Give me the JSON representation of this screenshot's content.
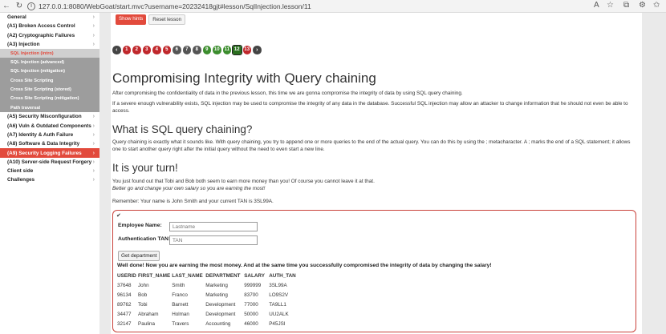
{
  "browser": {
    "url": "127.0.0.1:8080/WebGoat/start.mvc?username=20232418gjt#lesson/SqlInjection.lesson/11"
  },
  "toolbar": {
    "show_hints": "Show hints",
    "reset_lesson": "Reset lesson"
  },
  "sidebar": {
    "items_before": [
      {
        "label": "General"
      },
      {
        "label": "(A1) Broken Access Control"
      },
      {
        "label": "(A2) Cryptographic Failures"
      },
      {
        "label": "(A3) Injection"
      }
    ],
    "injection_subitems": [
      {
        "label": "SQL Injection (intro)"
      },
      {
        "label": "SQL Injection (advanced)"
      },
      {
        "label": "SQL Injection (mitigation)"
      },
      {
        "label": "Cross Site Scripting"
      },
      {
        "label": "Cross Site Scripting (stored)"
      },
      {
        "label": "Cross Site Scripting (mitigation)"
      },
      {
        "label": "Path traversal"
      }
    ],
    "items_after": [
      {
        "label": "(A5) Security Misconfiguration"
      },
      {
        "label": "(A6) Vuln & Outdated Components"
      },
      {
        "label": "(A7) Identity & Auth Failure"
      },
      {
        "label": "(A8) Software & Data Integrity"
      },
      {
        "label": "(A9) Security Logging Failures"
      },
      {
        "label": "(A10) Server-side Request Forgery"
      },
      {
        "label": "Client side"
      },
      {
        "label": "Challenges"
      }
    ]
  },
  "pager": {
    "pages": [
      "1",
      "2",
      "3",
      "4",
      "5",
      "6",
      "7",
      "8",
      "9",
      "10",
      "11",
      "12",
      "13"
    ],
    "current": "12"
  },
  "lesson": {
    "title": "Compromising Integrity with Query chaining",
    "intro": "After compromising the confidentiality of data in the previous lesson, this time we are gonna compromise the integrity of data by using SQL query chaining.",
    "para2": "If a severe enough vulnerability exists, SQL injection may be used to compromise the integrity of any data in the database. Successful SQL injection may allow an attacker to change information that he should not even be able to access.",
    "h2_chaining": "What is SQL query chaining?",
    "chaining_text": "Query chaining is exactly what it sounds like. With query chaining, you try to append one or more queries to the end of the actual query. You can do this by using the ; metacharacter. A ; marks the end of a SQL statement; it allows one to start another query right after the initial query without the need to even start a new line.",
    "h2_turn": "It is your turn!",
    "turn_line1": "You just found out that Tobi and Bob both seem to earn more money than you! Of course you cannot leave it at that.",
    "turn_line2": "Better go and change your own salary so you are earning the most!",
    "remember": "Remember: Your name is John Smith and your current TAN is 3SL99A."
  },
  "form": {
    "check_glyph": "✔",
    "employee_label": "Employee Name:",
    "employee_placeholder": "Lastname",
    "tan_label": "Authentication TAN:",
    "tan_placeholder": "TAN",
    "submit_label": "Get department",
    "success_message": "Well done! Now you are earning the most money. And at the same time you successfully compromised the integrity of data by changing the salary!"
  },
  "results": {
    "headers": [
      "USERID",
      "FIRST_NAME",
      "LAST_NAME",
      "DEPARTMENT",
      "SALARY",
      "AUTH_TAN"
    ],
    "rows": [
      [
        "37648",
        "John",
        "Smith",
        "Marketing",
        "999999",
        "3SL99A"
      ],
      [
        "96134",
        "Bob",
        "Franco",
        "Marketing",
        "83700",
        "LO9S2V"
      ],
      [
        "89762",
        "Tobi",
        "Barnett",
        "Development",
        "77000",
        "TA9LL1"
      ],
      [
        "34477",
        "Abraham",
        "Holman",
        "Development",
        "50000",
        "UU2ALK"
      ],
      [
        "32147",
        "Paulina",
        "Travers",
        "Accounting",
        "46000",
        "P45JSI"
      ]
    ]
  }
}
